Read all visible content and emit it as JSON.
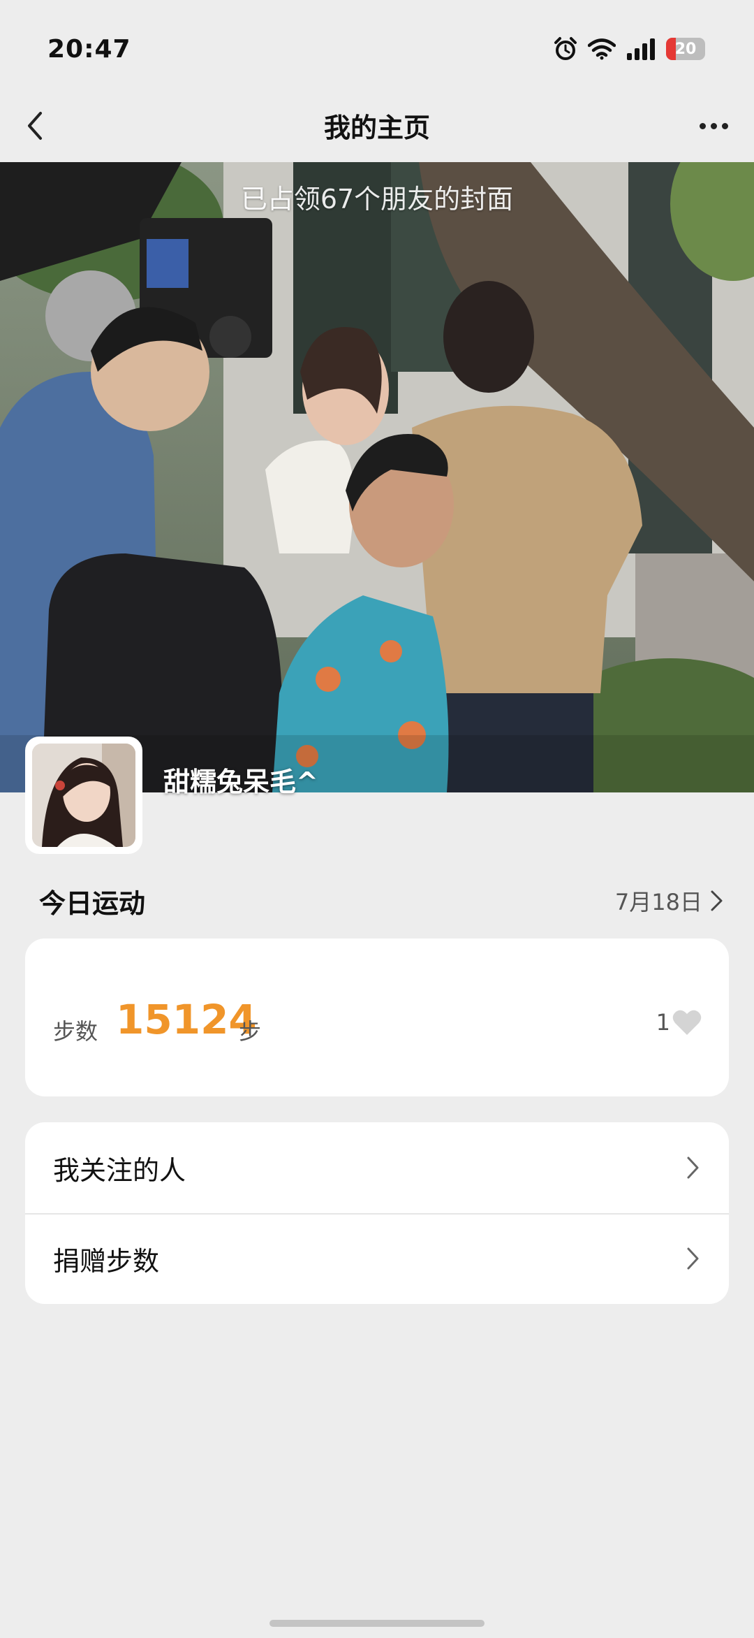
{
  "status_bar": {
    "time": "20:47",
    "battery": "20"
  },
  "nav": {
    "title": "我的主页"
  },
  "cover": {
    "caption": "已占领67个朋友的封面",
    "username": "甜糯兔呆毛^"
  },
  "today": {
    "title": "今日运动",
    "date": "7月18日"
  },
  "steps": {
    "label": "步数",
    "value": "15124",
    "unit": "步",
    "likes": "1"
  },
  "menu": [
    {
      "label": "我关注的人"
    },
    {
      "label": "捐赠步数"
    }
  ],
  "colors": {
    "accent": "#f0952a",
    "background": "#ededed",
    "battery_low": "#e53935"
  }
}
